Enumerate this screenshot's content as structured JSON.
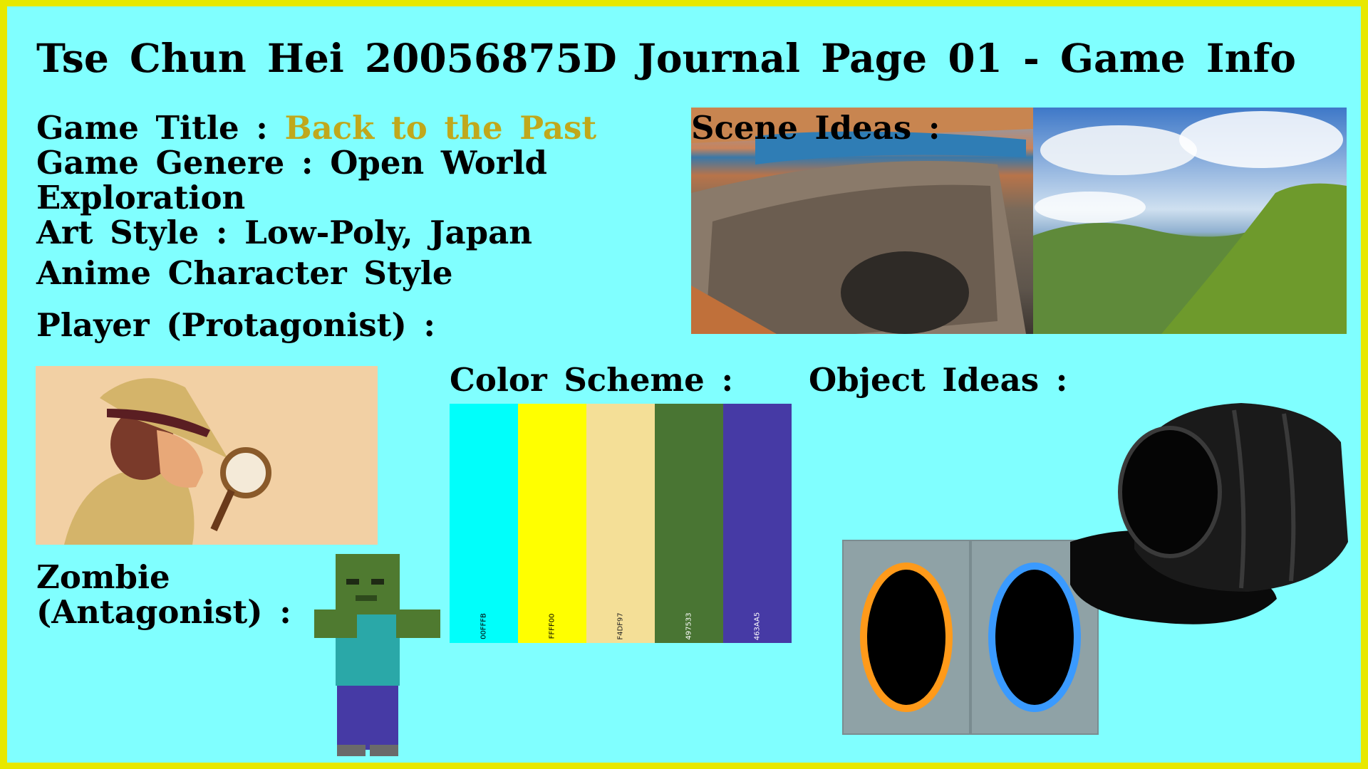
{
  "title": "Tse Chun Hei 20056875D Journal Page 01 - Game Info",
  "info": {
    "game_title_label": "Game Title :",
    "game_title_value": "Back to the Past",
    "genre_line1": "Game Genere : Open World",
    "genre_line2": "Exploration",
    "art_line1": "Art Style : Low-Poly, Japan",
    "art_line2": "Anime Character Style",
    "player_label": "Player (Protagonist) :",
    "zombie_line1": "Zombie",
    "zombie_line2": "(Antagonist) :"
  },
  "scene_label": "Scene Ideas :",
  "color_scheme_label": "Color Scheme :",
  "object_ideas_label": "Object Ideas :",
  "swatches": [
    {
      "hex": "00FFFB",
      "color": "#00FFFB",
      "text": "#000000"
    },
    {
      "hex": "FFFF00",
      "color": "#FFFF00",
      "text": "#000000"
    },
    {
      "hex": "F4DF97",
      "color": "#F4DF97",
      "text": "#222222"
    },
    {
      "hex": "497533",
      "color": "#497533",
      "text": "#ffffff"
    },
    {
      "hex": "463AA5",
      "color": "#463AA5",
      "text": "#ffffff"
    }
  ],
  "colors": {
    "border": "#e8e800",
    "background": "#80ffff",
    "accent": "#c0a81c"
  }
}
